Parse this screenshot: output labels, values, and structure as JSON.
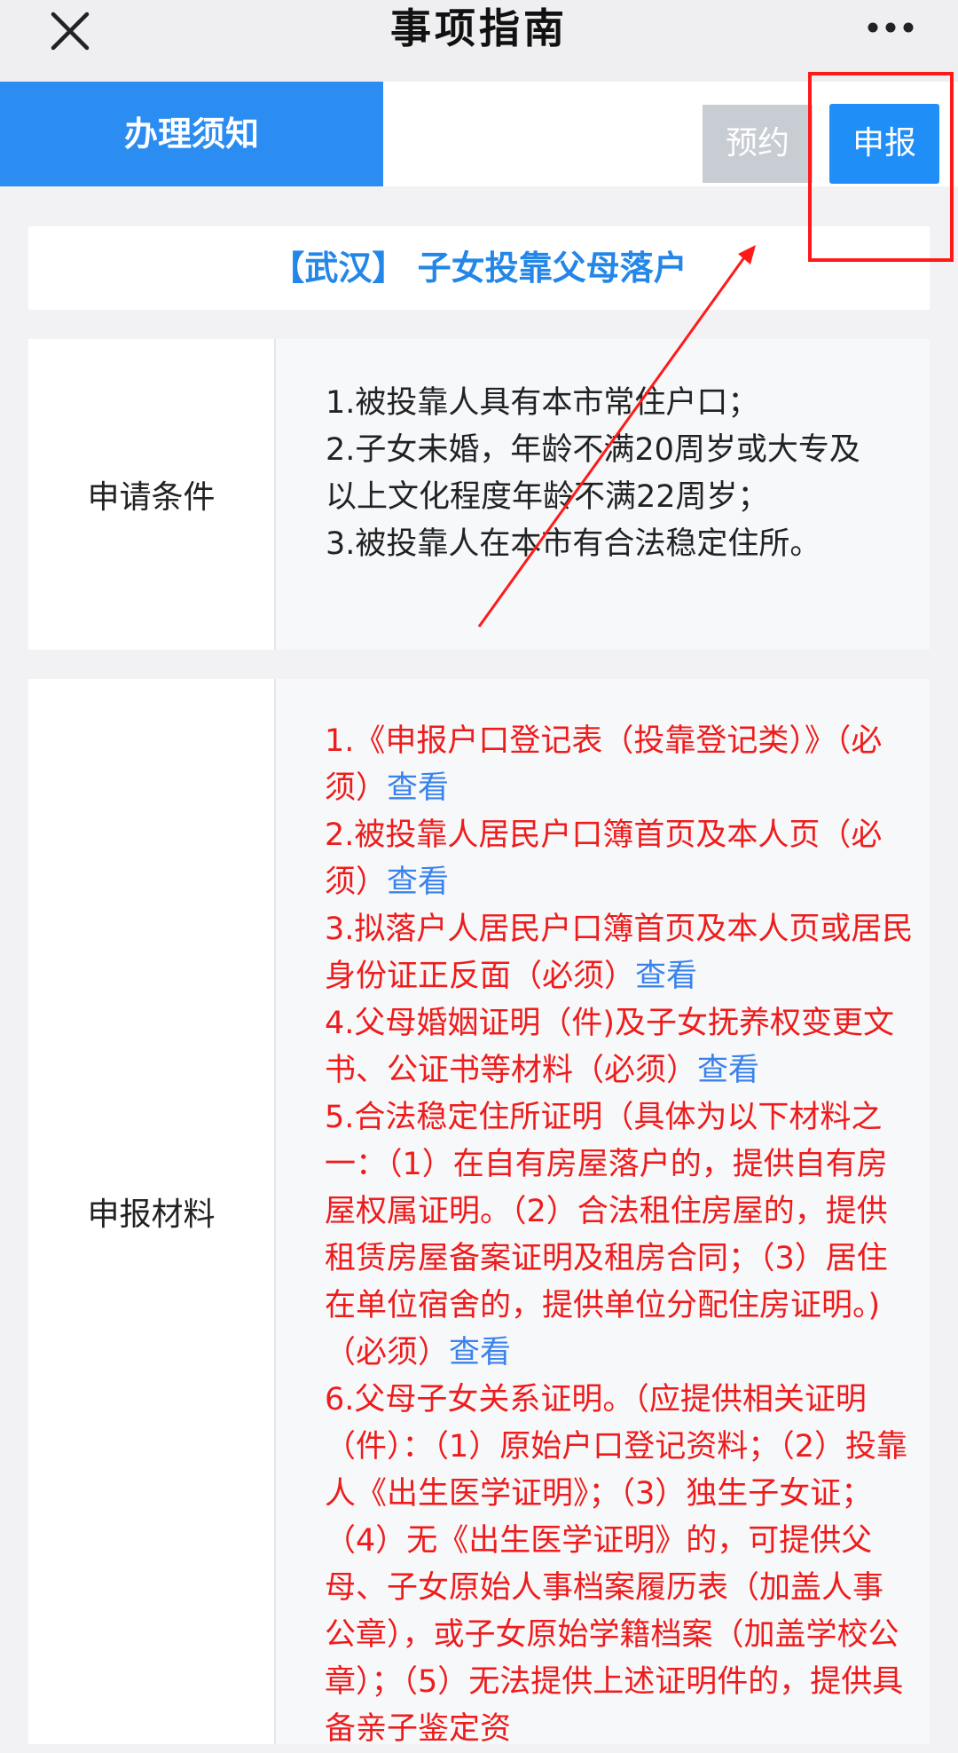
{
  "header": {
    "title": "事项指南",
    "close_icon": "close-icon",
    "more_icon": "more-icon"
  },
  "tabs": {
    "notice_label": "办理须知",
    "appointment_label": "预约",
    "apply_label": "申报"
  },
  "service": {
    "title": "【武汉】 子女投靠父母落户"
  },
  "conditions": {
    "label": "申请条件",
    "lines": [
      "1.被投靠人具有本市常住户口；",
      "2.子女未婚，年龄不满20周岁或大专及",
      "以上文化程度年龄不满22周岁；",
      "3.被投靠人在本市有合法稳定住所。"
    ]
  },
  "materials": {
    "label": "申报材料",
    "view_label": "查看",
    "items": [
      "1.《申报户口登记表（投靠登记类）》（必须）",
      "2.被投靠人居民户口簿首页及本人页（必须）",
      "3.拟落户人居民户口簿首页及本人页或居民身份证正反面（必须）",
      "4.父母婚姻证明（件)及子女抚养权变更文书、公证书等材料（必须）",
      "5.合法稳定住所证明（具体为以下材料之一：（1）在自有房屋落户的，提供自有房屋权属证明。（2）合法租住房屋的，提供租赁房屋备案证明及租房合同；（3）居住在单位宿舍的，提供单位分配住房证明。)（必须）",
      "6.父母子女关系证明。（应提供相关证明（件）：（1）原始户口登记资料；（2）投靠人《出生医学证明》；（3）独生子女证；（4）无《出生医学证明》的，可提供父母、子女原始人事档案履历表（加盖人事公章），或子女原始学籍档案（加盖学校公章）；（5）无法提供上述证明件的，提供具备亲子鉴定资"
    ]
  },
  "colors": {
    "primary_blue": "#2b8cf2",
    "title_blue": "#2487e8",
    "link_blue": "#3a82ec",
    "required_red": "#ee1c1c",
    "disabled_gray": "#c8ccd3",
    "annotation_red": "#ff1a1a"
  }
}
